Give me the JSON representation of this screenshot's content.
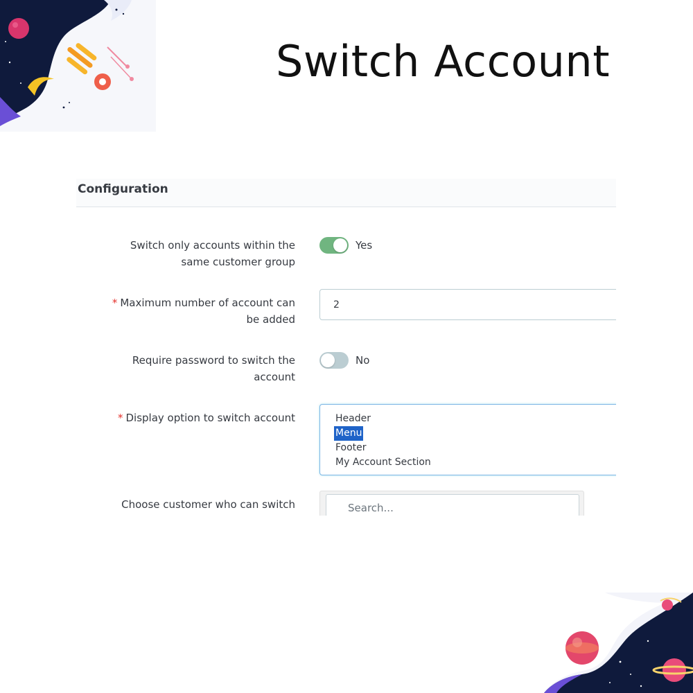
{
  "title": "Switch Account",
  "panel": {
    "title": "Configuration"
  },
  "fields": {
    "same_group": {
      "label_line1": "Switch only accounts within the",
      "label_line2": "same customer group",
      "value": "Yes",
      "enabled": true
    },
    "max_accounts": {
      "required_mark": "*",
      "label_line1": "Maximum number of account can",
      "label_line2": "be added",
      "value": "2"
    },
    "require_password": {
      "label_line1": "Require password to switch the",
      "label_line2": "account",
      "value": "No",
      "enabled": false
    },
    "display_option": {
      "required_mark": "*",
      "label": "Display option to switch account",
      "options": [
        "Header",
        "Menu",
        "Footer",
        "My Account Section"
      ],
      "selected": "Menu"
    },
    "choose_customer": {
      "label": "Choose customer who can switch",
      "placeholder": "Search..."
    }
  },
  "colors": {
    "switch_on": "#70b580",
    "switch_off": "#bbcdd2",
    "required": "#e5322d",
    "selected_option": "#1f63c8",
    "listbox_focus_border": "#7cb5e4"
  },
  "decorations": [
    "space-illustration-top-left",
    "space-illustration-bottom-right"
  ]
}
